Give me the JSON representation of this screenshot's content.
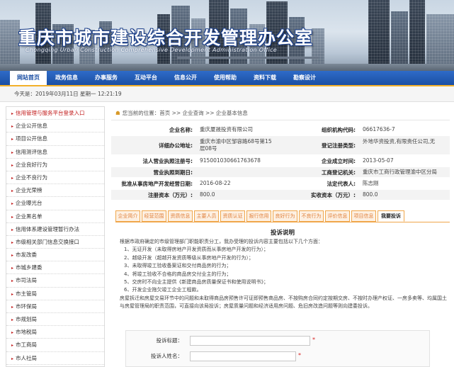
{
  "header": {
    "title": "重庆市城市建设综合开发管理办公室",
    "subtitle": "Chongqing Urban Construction Comprehensive Development Administration Office"
  },
  "nav": {
    "items": [
      "网站首页",
      "政务信息",
      "办事服务",
      "互动平台",
      "信息公开",
      "使用帮助",
      "资料下载",
      "勘察设计"
    ]
  },
  "datebar": {
    "text": "今天是：2019年03月11日 星期一 12:21:19"
  },
  "sidebar": {
    "items": [
      "信用管理与服务平台登录入口",
      "企业公开信息",
      "项目公开信息",
      "信用测评信息",
      "企业良好行为",
      "企业不良行为",
      "企业光荣榜",
      "企业曝光台",
      "企业黑名单",
      "信用体系建设管理暂行办法",
      "市级相关部门信息交换接口",
      "市发改委",
      "市城乡建委",
      "市司法局",
      "市主管局",
      "市环保局",
      "市规划局",
      "市地税局",
      "市工商局",
      "市人社局"
    ]
  },
  "breadcrumb": {
    "prefix": "您当前的位置：",
    "path": "首页 >> 企业查询 >> 企业基本信息"
  },
  "company": {
    "name_label": "企业名称:",
    "name": "重庆厦晟投资有限公司",
    "org_code_label": "组织机构代码:",
    "org_code": "06617636-7",
    "address_label": "详细办公地址:",
    "address": "重庆市渝中区邹容路68号第15层08号",
    "reg_type_label": "登记注册类型:",
    "reg_type": "外地华资投资,有限责任公司,无",
    "license_label": "法人营业执照注册号:",
    "license": "915001030661763678",
    "founded_label": "企业成立时间:",
    "founded": "2013-05-07",
    "license_date_label": "营业执照到期日:",
    "license_date": "",
    "registry_label": "工商登记机关:",
    "registry": "重庆市工商行政管理渝中区分局",
    "approval_date_label": "批准从事房地产开发经营日期:",
    "approval_date": "2016-08-22",
    "legal_rep_label": "法定代表人:",
    "legal_rep": "陈志刚",
    "reg_capital_label": "注册资本（万元）:",
    "reg_capital": "800.0",
    "paid_capital_label": "实收资本（万元）:",
    "paid_capital": "800.0"
  },
  "tabs": [
    "企业简介",
    "经营范围",
    "资质信息",
    "主要人员",
    "资质认证",
    "报行信用",
    "良好行为",
    "不良行为",
    "评价信息",
    "项目信息",
    "我要投诉"
  ],
  "complaint": {
    "title": "投诉说明",
    "lines": [
      "根据市政府确定的市级管理部门职能职责分工，我办受理的投诉内容主要包括以下几个方面：",
      "1、无证开发（未取得房地产开发资质而从事房地产开发的行为）；",
      "2、越级开发（超越开发资质等级从事房地产开发的行为）；",
      "3、未取得竣工验收备案证和交付商品房的行为；",
      "4、将竣工验收不合格的商品房交付业主的行为；",
      "5、交房时不向业主提供《新建商品房质量保证书和使用说明书》；",
      "6、开发企业拖欠竣工企业工程款。",
      "房屋拆迁和房屋交易环节中的问题和未取得商品房预售许可证即预售商品房、不按购房合同约定按期交房、不按时办理产权证、一房多卖等、均属国土与房屋管理局的职责范围，可直接向该局投诉；房屋质量问题和经济适用房问题、危旧房改造问题等则向建委投诉。"
    ]
  },
  "form": {
    "title_label": "投诉标题：",
    "name_label": "投诉人姓名："
  }
}
